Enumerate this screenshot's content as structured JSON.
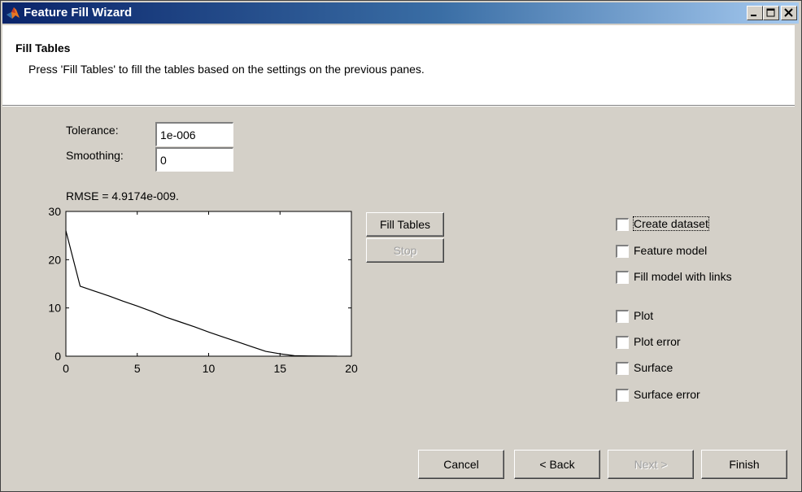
{
  "window": {
    "title": "Feature Fill Wizard",
    "minimize_label": "minimize",
    "maximize_label": "maximize",
    "close_label": "close"
  },
  "header": {
    "title": "Fill Tables",
    "description": "Press 'Fill Tables' to fill the tables based on the settings on the previous panes."
  },
  "settings": {
    "tolerance_label": "Tolerance:",
    "tolerance_value": "1e-006",
    "smoothing_label": "Smoothing:",
    "smoothing_value": "0"
  },
  "rmse_text": "RMSE = 4.9174e-009.",
  "actions": {
    "fill_tables": "Fill Tables",
    "stop": "Stop"
  },
  "options": [
    {
      "label": "Create dataset",
      "checked": false,
      "focused": true
    },
    {
      "label": "Feature model",
      "checked": false
    },
    {
      "label": "Fill model with links",
      "checked": false
    },
    {
      "label": "Plot",
      "checked": false
    },
    {
      "label": "Plot error",
      "checked": false
    },
    {
      "label": "Surface",
      "checked": false
    },
    {
      "label": "Surface error",
      "checked": false
    }
  ],
  "footer": {
    "cancel": "Cancel",
    "back": "< Back",
    "next": "Next >",
    "finish": "Finish"
  },
  "colors": {
    "title_bar_start": "#0a246a",
    "title_bar_end": "#a6caf0",
    "dialog_bg": "#d4d0c8"
  },
  "chart_data": {
    "type": "line",
    "title": "",
    "xlabel": "",
    "ylabel": "",
    "xlim": [
      0,
      20
    ],
    "ylim": [
      0,
      30
    ],
    "xticks": [
      0,
      5,
      10,
      15,
      20
    ],
    "yticks": [
      0,
      10,
      20,
      30
    ],
    "grid": false,
    "series": [
      {
        "x": [
          0,
          1,
          2,
          3,
          4,
          5,
          6,
          7,
          8,
          9,
          10,
          11,
          12,
          13,
          14,
          15,
          16,
          17,
          18,
          19
        ],
        "y": [
          26,
          14.5,
          13.5,
          12.5,
          11.4,
          10.4,
          9.3,
          8.1,
          7.1,
          6.1,
          5.0,
          4.0,
          3.0,
          2.0,
          1.0,
          0.5,
          0.1,
          0.05,
          0.02,
          0.01
        ]
      }
    ]
  }
}
